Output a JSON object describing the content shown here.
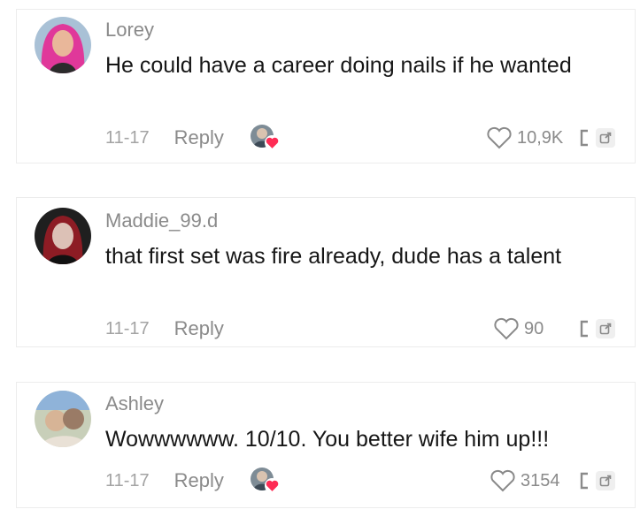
{
  "colors": {
    "heart_badge": "#fe2c55",
    "muted": "#8a8a8a"
  },
  "comments": [
    {
      "username": "Lorey",
      "text": "He could have a career doing nails if he wanted",
      "date": "11-17",
      "reply_label": "Reply",
      "likes": "10,9K",
      "has_creator_like": true
    },
    {
      "username": "Maddie_99.d",
      "text": "that first set was fire already, dude has a talent",
      "date": "11-17",
      "reply_label": "Reply",
      "likes": "90",
      "has_creator_like": false
    },
    {
      "username": "Ashley",
      "text": "Wowwwwww. 10/10. You better wife him up!!!",
      "date": "11-17",
      "reply_label": "Reply",
      "likes": "3154",
      "has_creator_like": true
    }
  ]
}
